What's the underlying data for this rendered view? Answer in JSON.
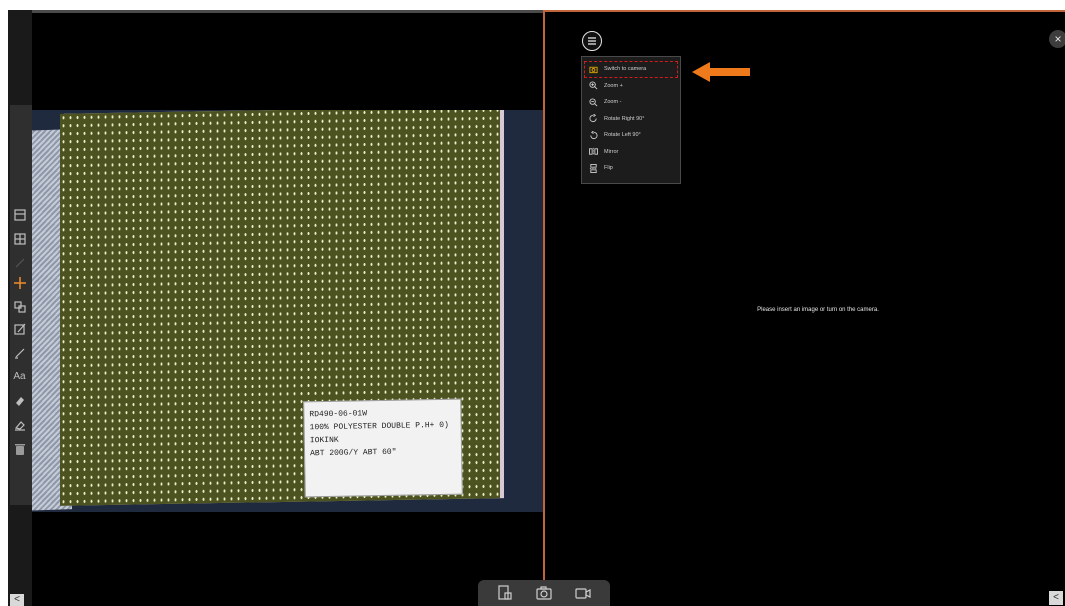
{
  "toolbar": {
    "tools": [
      "square-icon",
      "grid-icon",
      "line-icon",
      "pointer-icon",
      "crop-icon",
      "note-icon",
      "pen-icon",
      "text-icon",
      "highlighter-icon",
      "eraser-icon",
      "trash-icon"
    ],
    "text_tool_label": "Aa",
    "scroll_left": "<"
  },
  "photo": {
    "label_lines": [
      "RD490-06-01W",
      "100% POLYESTER DOUBLE P.H+   0)",
      "IOKINK",
      "ABT 200G/Y     ABT 60\""
    ]
  },
  "context_menu": {
    "items": [
      {
        "label": "Switch to camera",
        "icon": "camera-icon",
        "active": true
      },
      {
        "label": "Zoom +",
        "icon": "zoom-in-icon"
      },
      {
        "label": "Zoom -",
        "icon": "zoom-out-icon"
      },
      {
        "label": "Rotate Right 90°",
        "icon": "rotate-right-icon"
      },
      {
        "label": "Rotate Left 90°",
        "icon": "rotate-left-icon"
      },
      {
        "label": "Mirror",
        "icon": "mirror-icon"
      },
      {
        "label": "Flip",
        "icon": "flip-icon"
      }
    ]
  },
  "right_pane": {
    "placeholder": "Please insert an image or turn on the camera.",
    "close_symbol": "×",
    "scroll_right": "<"
  },
  "bottom_bar": {
    "buttons": [
      "import-image-icon",
      "camera-icon",
      "video-icon"
    ]
  },
  "colors": {
    "accent": "#c0643a",
    "arrow": "#ee7a1c",
    "highlight_outline": "#d21c1c"
  }
}
